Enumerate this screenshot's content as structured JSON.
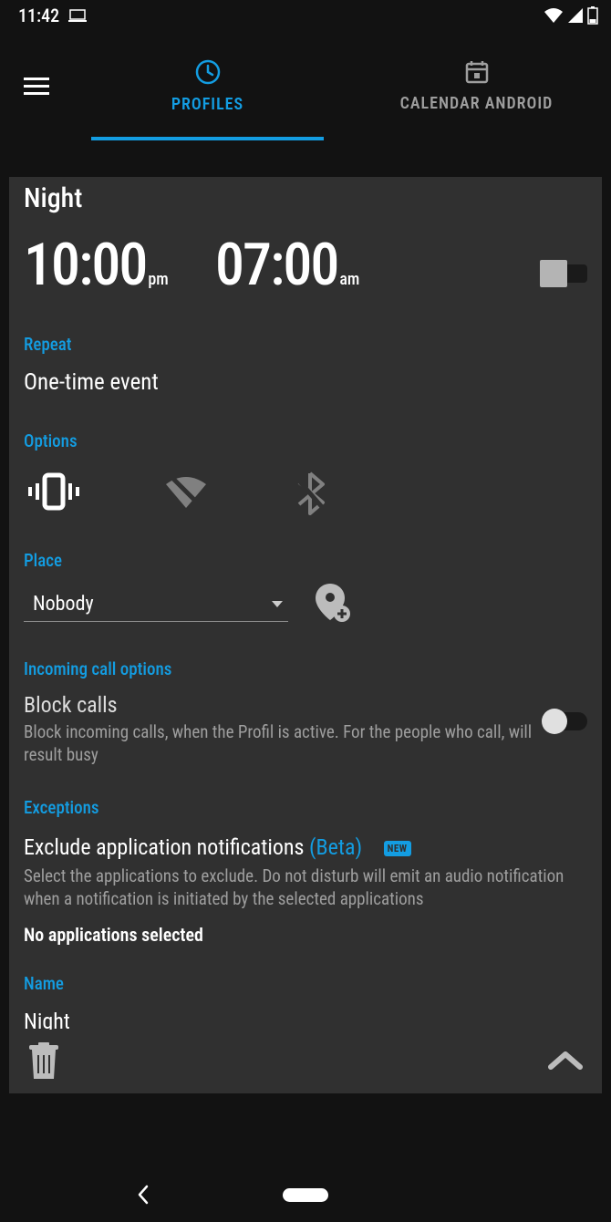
{
  "statusbar": {
    "time": "11:42"
  },
  "tabs": {
    "profiles": "PROFILES",
    "calendar": "CALENDAR ANDROID"
  },
  "profile": {
    "title": "Night",
    "start_time": "10:00",
    "start_suffix": "pm",
    "end_time": "07:00",
    "end_suffix": "am"
  },
  "sections": {
    "repeat_label": "Repeat",
    "repeat_value": "One-time event",
    "options_label": "Options",
    "place_label": "Place",
    "place_value": "Nobody",
    "incoming_label": "Incoming call options",
    "block_title": "Block calls",
    "block_desc": "Block incoming calls, when the Profil is active. For the people who call, will result busy",
    "exceptions_label": "Exceptions",
    "exclude_title": "Exclude application notifications ",
    "exclude_beta": "(Beta)",
    "exclude_new": "NEW",
    "exclude_desc": "Select the applications to exclude. Do not disturb will emit an audio notification when a notification is initiated by the selected applications",
    "exclude_none": "No applications selected",
    "name_label": "Name",
    "name_value": "Night"
  }
}
